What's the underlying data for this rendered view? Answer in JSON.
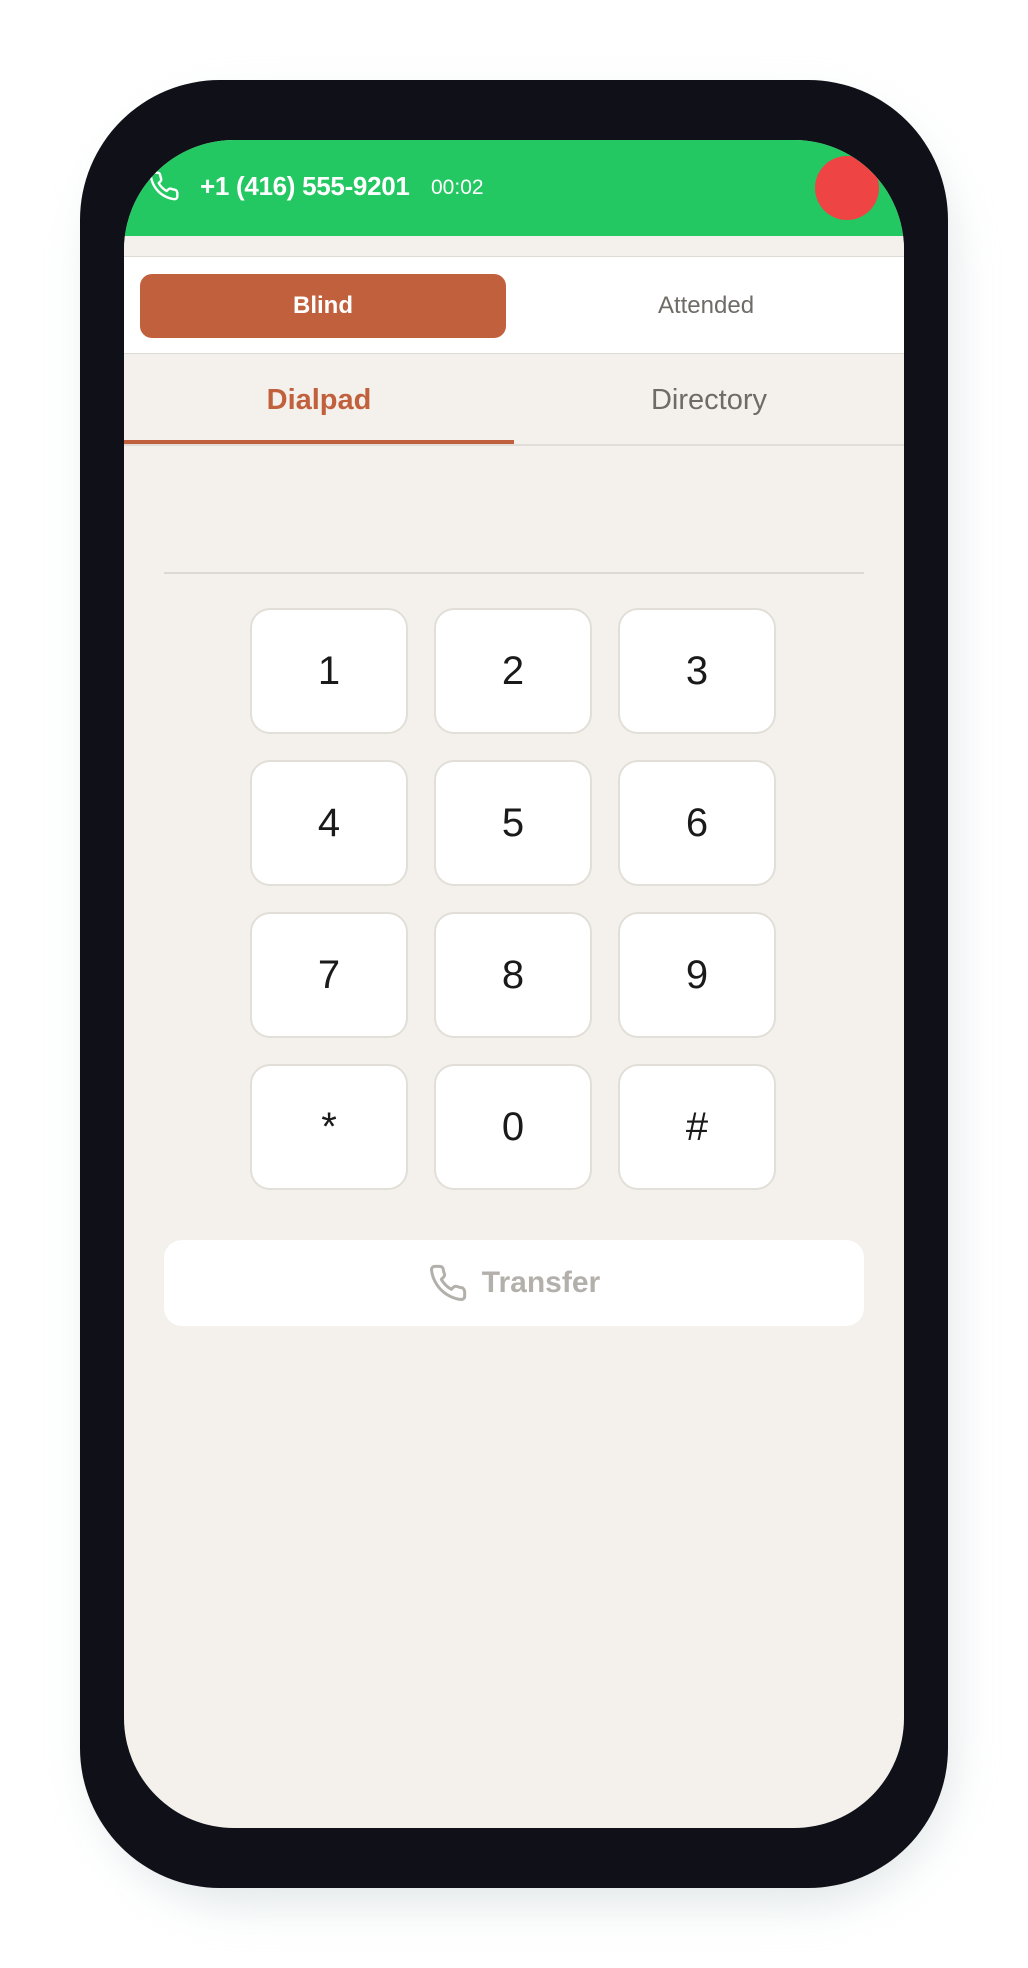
{
  "colors": {
    "call_bar": "#24c862",
    "accent": "#c1603d",
    "hangup": "#ef4444",
    "device_frame": "#0f1018",
    "screen_bg": "#f4f1ec"
  },
  "call": {
    "icon": "phone-icon",
    "number": "+1 (416) 555-9201",
    "timer": "00:02",
    "hangup_icon": "hangup-dot"
  },
  "transfer_mode": {
    "options": [
      "Blind",
      "Attended"
    ],
    "selected": "Blind"
  },
  "tabs": {
    "items": [
      "Dialpad",
      "Directory"
    ],
    "active": "Dialpad"
  },
  "dialpad": {
    "entered_number": "",
    "keys": [
      "1",
      "2",
      "3",
      "4",
      "5",
      "6",
      "7",
      "8",
      "9",
      "*",
      "0",
      "#"
    ]
  },
  "transfer_button": {
    "icon": "phone-icon",
    "label": "Transfer",
    "enabled": false
  }
}
